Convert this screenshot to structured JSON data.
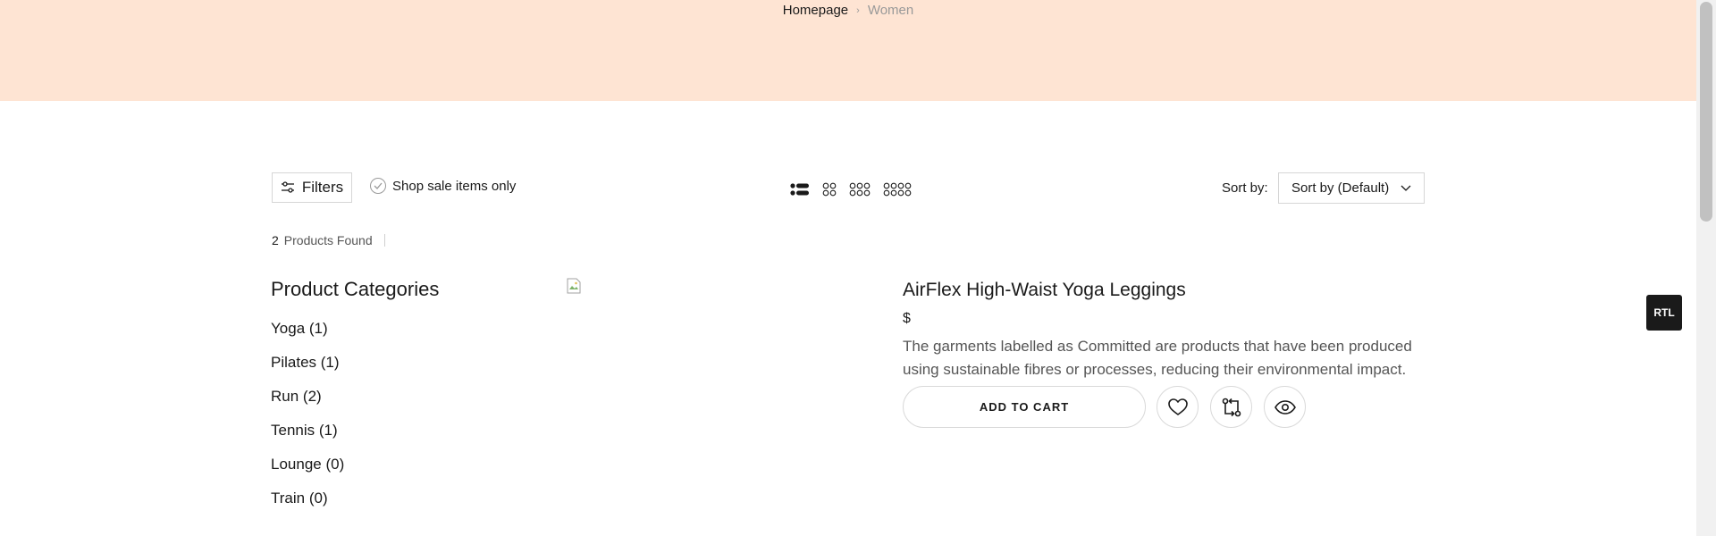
{
  "breadcrumb": {
    "home": "Homepage",
    "separator": "›",
    "current": "Women"
  },
  "toolbar": {
    "filters_label": "Filters",
    "sale_only_label": "Shop sale items only",
    "sort_label": "Sort by:",
    "sort_value": "Sort by (Default)",
    "layouts": [
      "list",
      "grid-2",
      "grid-3",
      "grid-4"
    ],
    "active_layout": "list"
  },
  "results": {
    "count": "2",
    "label": "Products Found"
  },
  "sidebar": {
    "title": "Product Categories",
    "categories": [
      {
        "label": "Yoga (1)"
      },
      {
        "label": "Pilates (1)"
      },
      {
        "label": "Run (2)"
      },
      {
        "label": "Tennis (1)"
      },
      {
        "label": "Lounge (0)"
      },
      {
        "label": "Train (0)"
      }
    ]
  },
  "product": {
    "title": "AirFlex High-Waist Yoga Leggings",
    "price": "$",
    "description": "The garments labelled as Committed are products that have been produced using sustainable fibres or processes, reducing their environmental impact.",
    "add_to_cart": "ADD TO CART",
    "actions": [
      "heart-icon",
      "compare-icon",
      "eye-icon"
    ]
  },
  "rtl_label": "RTL",
  "colors": {
    "hero_bg": "#fee4d3",
    "text": "#1a1a1a",
    "muted": "#999999",
    "border": "#d9d9d9"
  }
}
